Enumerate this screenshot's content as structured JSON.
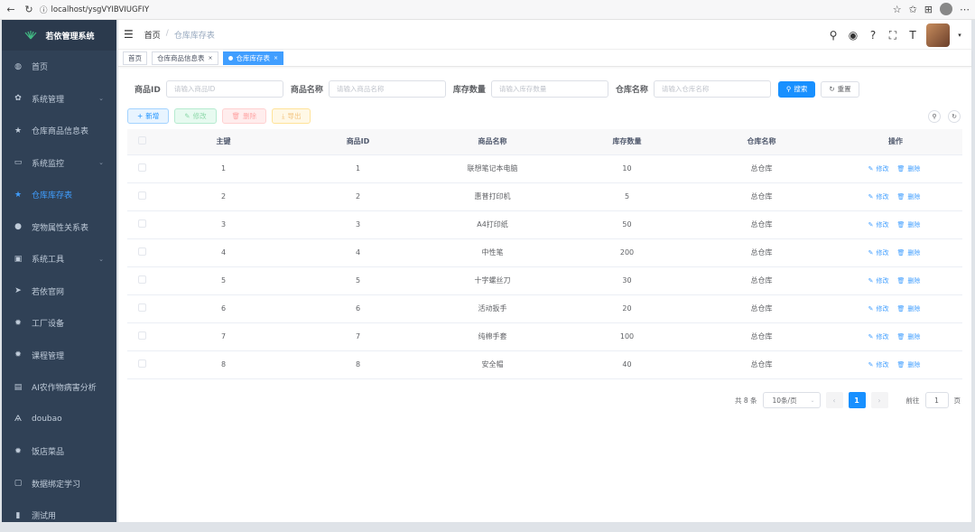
{
  "browser": {
    "url": "localhost/ysgVYIBVIUGFIY"
  },
  "sidebar": {
    "title": "若依管理系统",
    "items": [
      {
        "label": "首页",
        "icon": "dashboard-icon",
        "glyph": "◍",
        "arrow": false
      },
      {
        "label": "系统管理",
        "icon": "system-icon",
        "glyph": "✿",
        "arrow": true
      },
      {
        "label": "仓库商品信息表",
        "icon": "star-icon",
        "glyph": "★",
        "arrow": false
      },
      {
        "label": "系统监控",
        "icon": "monitor-icon",
        "glyph": "▭",
        "arrow": true
      },
      {
        "label": "仓库库存表",
        "icon": "star-icon",
        "glyph": "★",
        "arrow": false,
        "active": true
      },
      {
        "label": "宠物属性关系表",
        "icon": "user-icon",
        "glyph": "●",
        "arrow": false
      },
      {
        "label": "系统工具",
        "icon": "tool-icon",
        "glyph": "▣",
        "arrow": true
      },
      {
        "label": "若依官网",
        "icon": "guide-icon",
        "glyph": "➤",
        "arrow": false
      },
      {
        "label": "工厂设备",
        "icon": "bug-icon",
        "glyph": "✹",
        "arrow": false
      },
      {
        "label": "课程管理",
        "icon": "bug-icon",
        "glyph": "✹",
        "arrow": false
      },
      {
        "label": "AI农作物病害分析",
        "icon": "table-icon",
        "glyph": "▤",
        "arrow": false
      },
      {
        "label": "doubao",
        "icon": "language-icon",
        "glyph": "Ѧ",
        "arrow": false
      },
      {
        "label": "饭店菜品",
        "icon": "bug-icon",
        "glyph": "✹",
        "arrow": false
      },
      {
        "label": "数据绑定学习",
        "icon": "form-icon",
        "glyph": "▢",
        "arrow": false
      },
      {
        "label": "测试用",
        "icon": "chart-icon",
        "glyph": "▮",
        "arrow": false
      }
    ]
  },
  "navbar": {
    "breadcrumb_home": "首页",
    "breadcrumb_sep": "/",
    "breadcrumb_current": "仓库库存表"
  },
  "tags": [
    {
      "label": "首页",
      "active": false,
      "closable": false
    },
    {
      "label": "仓库商品信息表",
      "active": false,
      "closable": true
    },
    {
      "label": "仓库库存表",
      "active": true,
      "closable": true
    }
  ],
  "search": {
    "fields": [
      {
        "label": "商品ID",
        "placeholder": "请输入商品ID"
      },
      {
        "label": "商品名称",
        "placeholder": "请输入商品名称"
      },
      {
        "label": "库存数量",
        "placeholder": "请输入库存数量"
      },
      {
        "label": "仓库名称",
        "placeholder": "请输入仓库名称"
      }
    ],
    "search_label": "搜索",
    "reset_label": "重置"
  },
  "toolbar": {
    "add": "新增",
    "edit": "修改",
    "delete": "删除",
    "export": "导出"
  },
  "table": {
    "headers": [
      "主键",
      "商品ID",
      "商品名称",
      "库存数量",
      "仓库名称",
      "操作"
    ],
    "rows": [
      [
        "1",
        "1",
        "联想笔记本电脑",
        "10",
        "总仓库"
      ],
      [
        "2",
        "2",
        "惠普打印机",
        "5",
        "总仓库"
      ],
      [
        "3",
        "3",
        "A4打印纸",
        "50",
        "总仓库"
      ],
      [
        "4",
        "4",
        "中性笔",
        "200",
        "总仓库"
      ],
      [
        "5",
        "5",
        "十字螺丝刀",
        "30",
        "总仓库"
      ],
      [
        "6",
        "6",
        "活动扳手",
        "20",
        "总仓库"
      ],
      [
        "7",
        "7",
        "纯棉手套",
        "100",
        "总仓库"
      ],
      [
        "8",
        "8",
        "安全帽",
        "40",
        "总仓库"
      ]
    ],
    "op_edit": "修改",
    "op_delete": "删除"
  },
  "pagination": {
    "total": "共 8 条",
    "page_size": "10条/页",
    "current_page": "1",
    "goto_label": "前往",
    "goto_value": "1",
    "page_unit": "页"
  }
}
